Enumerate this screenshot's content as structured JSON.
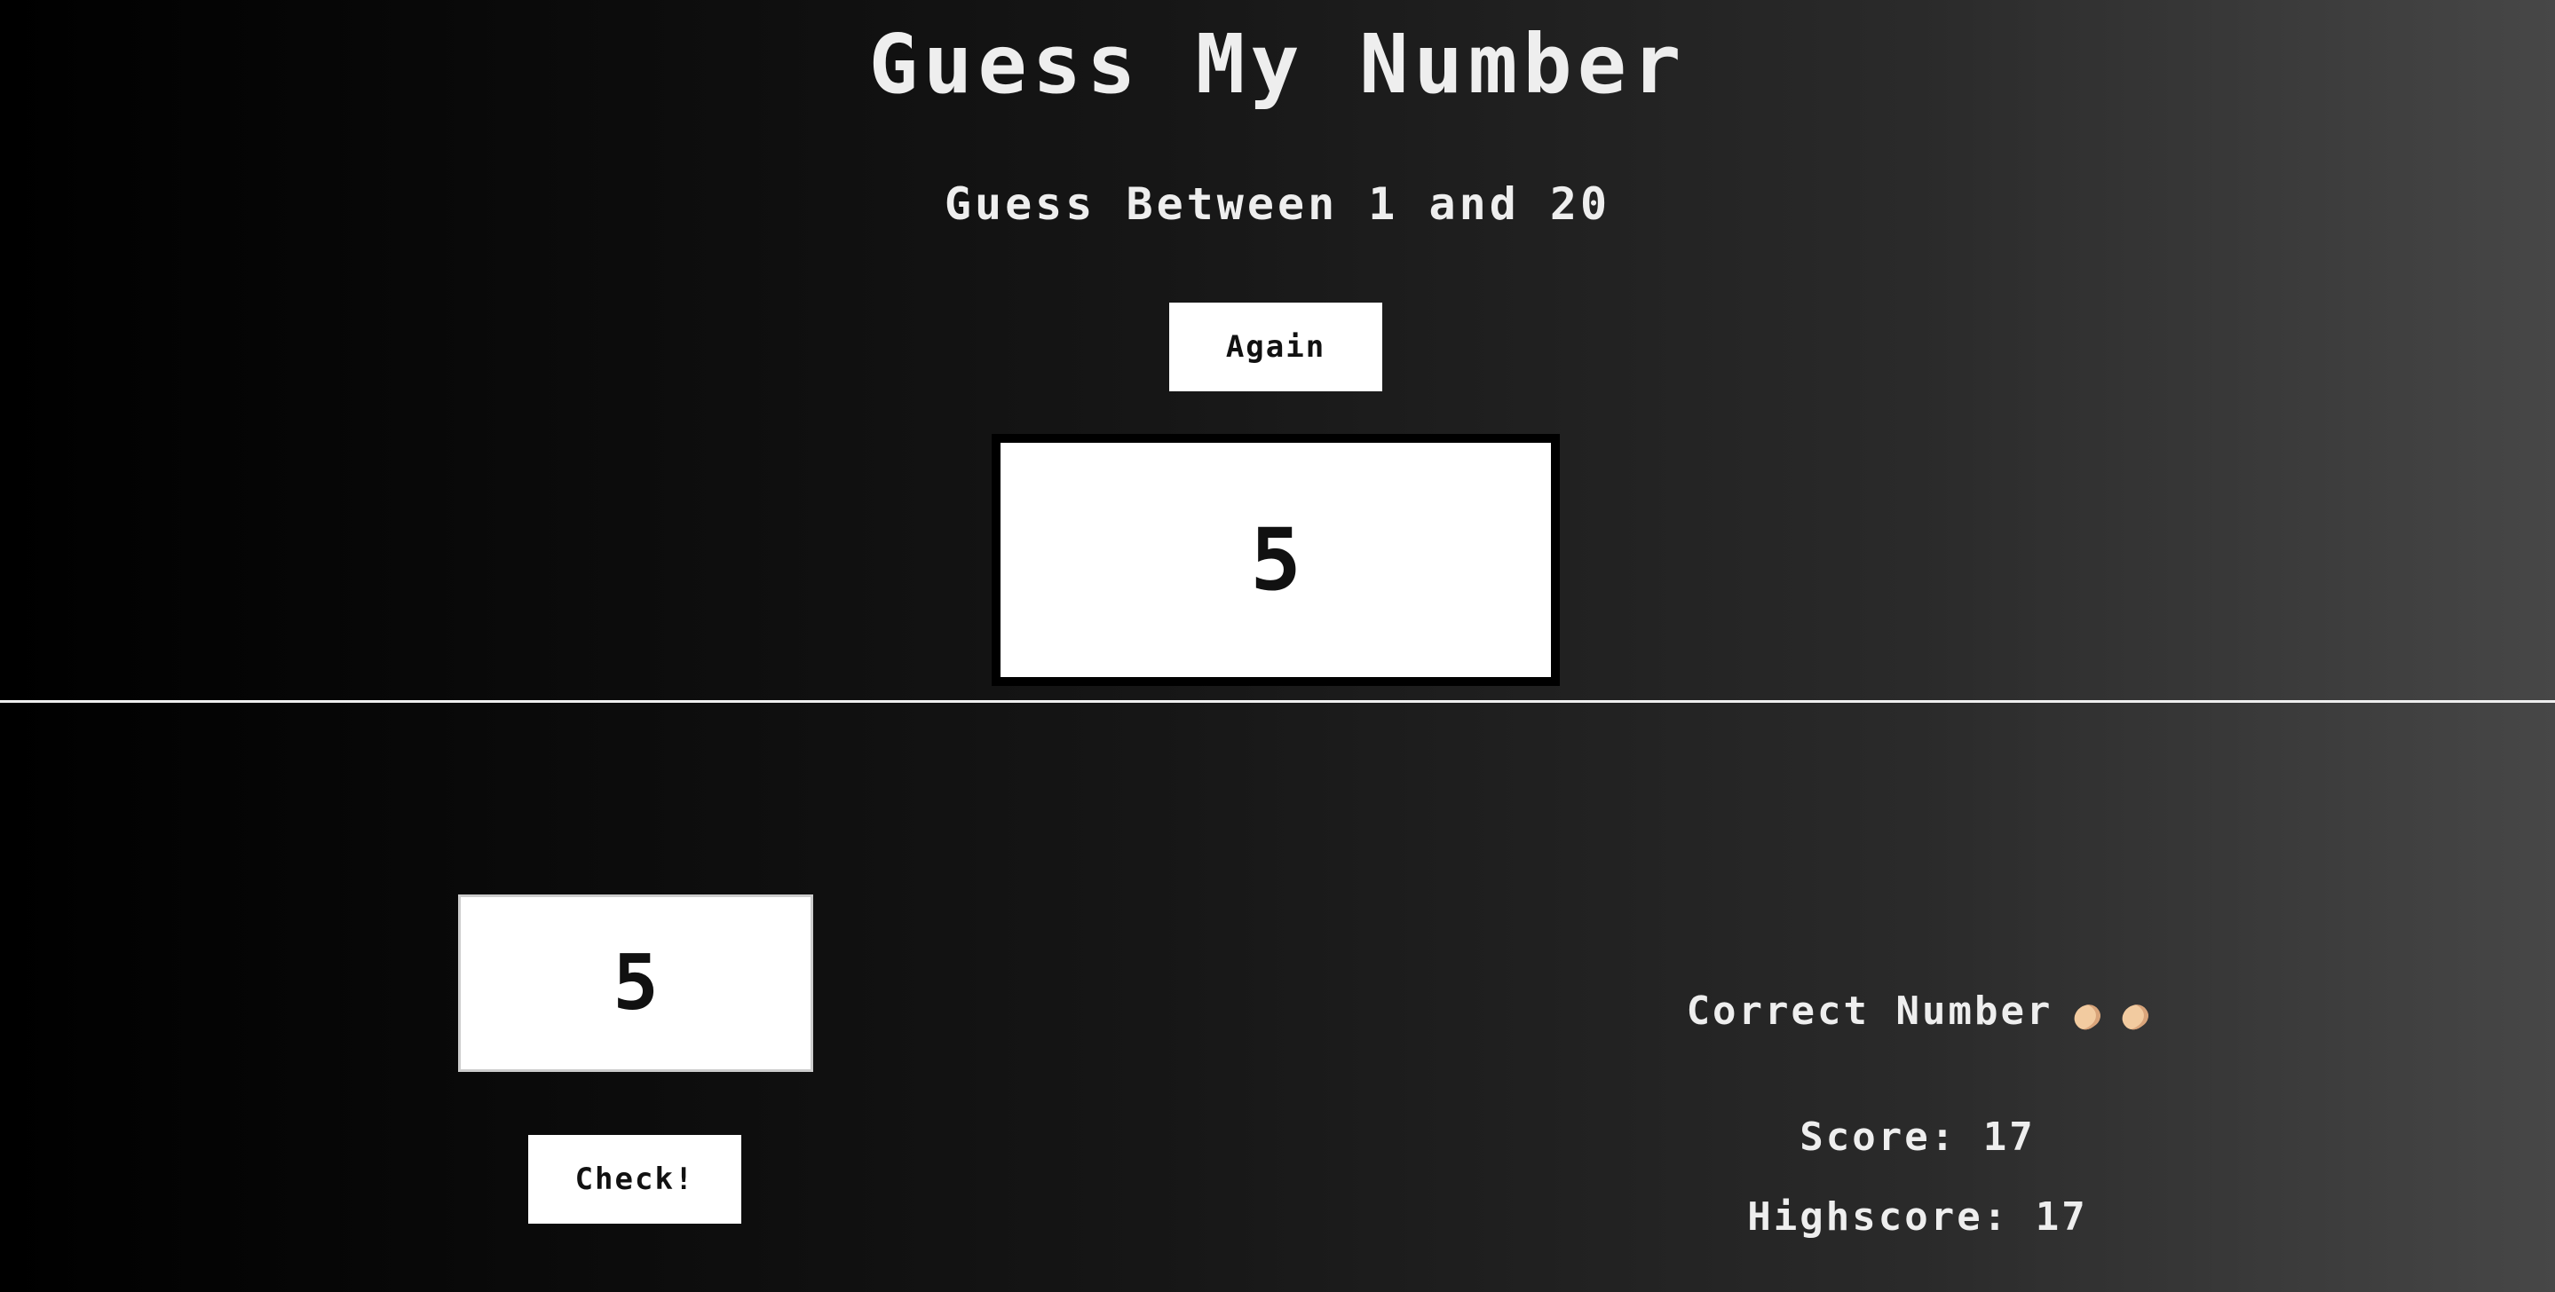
{
  "header": {
    "title": "Guess My Number",
    "between": "Guess Between 1 and 20",
    "again_label": "Again",
    "secret_number": "5"
  },
  "left": {
    "guess_value": "5",
    "check_label": "Check!"
  },
  "right": {
    "message": "Correct Number",
    "score_label": "Score: ",
    "score_value": "17",
    "highscore_label": "Highscore: ",
    "highscore_value": "17"
  },
  "icons": {
    "message_icons": [
      "clapping-hands-icon",
      "clapping-hands-icon"
    ]
  },
  "colors": {
    "text": "#eeeeee",
    "box": "#ffffff",
    "box_text": "#111111"
  }
}
